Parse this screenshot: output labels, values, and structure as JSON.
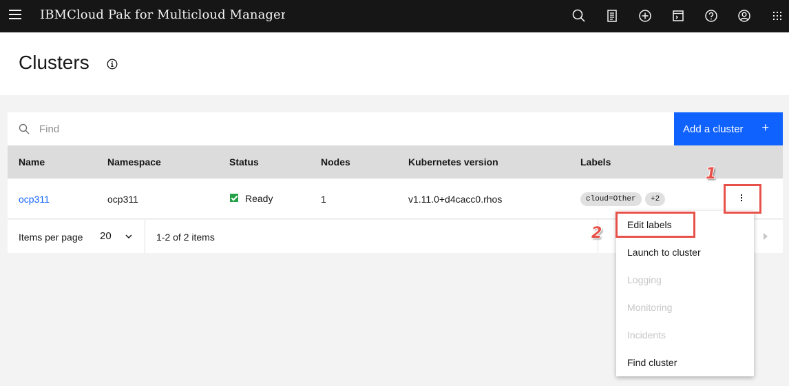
{
  "header": {
    "brand": "IBMCloud Pak for Multicloud Manager"
  },
  "page": {
    "title": "Clusters"
  },
  "search": {
    "placeholder": "Find"
  },
  "toolbar": {
    "add_label": "Add a cluster",
    "add_icon": "+"
  },
  "table": {
    "columns": [
      "Name",
      "Namespace",
      "Status",
      "Nodes",
      "Kubernetes version",
      "Labels"
    ],
    "rows": [
      {
        "name": "ocp311",
        "namespace": "ocp311",
        "status": "Ready",
        "nodes": "1",
        "kube_version": "v1.11.0+d4cacc0.rhos",
        "label_tag": "cloud=Other",
        "label_more": "+2"
      }
    ]
  },
  "pagination": {
    "items_per_page_label": "Items per page",
    "items_per_page_value": "20",
    "range": "1-2 of 2 items"
  },
  "menu": {
    "items": [
      {
        "label": "Edit labels",
        "disabled": false
      },
      {
        "label": "Launch to cluster",
        "disabled": false
      },
      {
        "label": "Logging",
        "disabled": true
      },
      {
        "label": "Monitoring",
        "disabled": true
      },
      {
        "label": "Incidents",
        "disabled": true
      },
      {
        "label": "Find cluster",
        "disabled": false
      }
    ]
  },
  "annotations": {
    "step1": "1",
    "step2": "2"
  },
  "colors": {
    "header_bg": "#161616",
    "primary": "#0f62fe",
    "status_ready": "#24a148",
    "annotation": "#e8514a"
  }
}
